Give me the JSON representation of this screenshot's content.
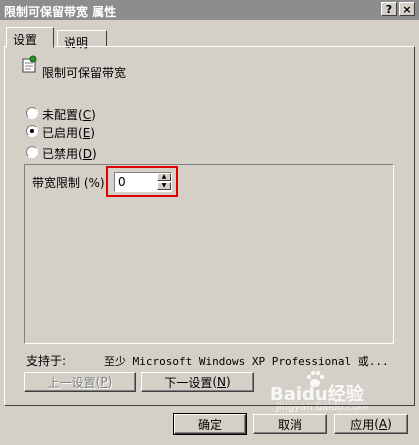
{
  "window": {
    "title": "限制可保留带宽 属性",
    "help_label": "?",
    "close_label": "×"
  },
  "tabs": [
    {
      "label": "设置"
    },
    {
      "label": "说明"
    }
  ],
  "setting": {
    "name": "限制可保留带宽"
  },
  "options": {
    "not_configured": {
      "label": "未配置",
      "key": "C"
    },
    "enabled": {
      "label": "已启用",
      "key": "E",
      "selected": true
    },
    "disabled": {
      "label": "已禁用",
      "key": "D"
    }
  },
  "bandwidth": {
    "label": "带宽限制 (%):",
    "value": "0"
  },
  "supported": {
    "label": "支持于:",
    "value": "至少 Microsoft Windows XP Professional 或..."
  },
  "nav": {
    "prev_label": "上一设置",
    "prev_key": "P",
    "next_label": "下一设置",
    "next_key": "N"
  },
  "footer": {
    "ok_label": "确定",
    "cancel_label": "取消",
    "apply_label": "应用",
    "apply_key": "A"
  },
  "watermark": {
    "brand": "Baidu经验",
    "url": "jingyan.baidu.com"
  }
}
